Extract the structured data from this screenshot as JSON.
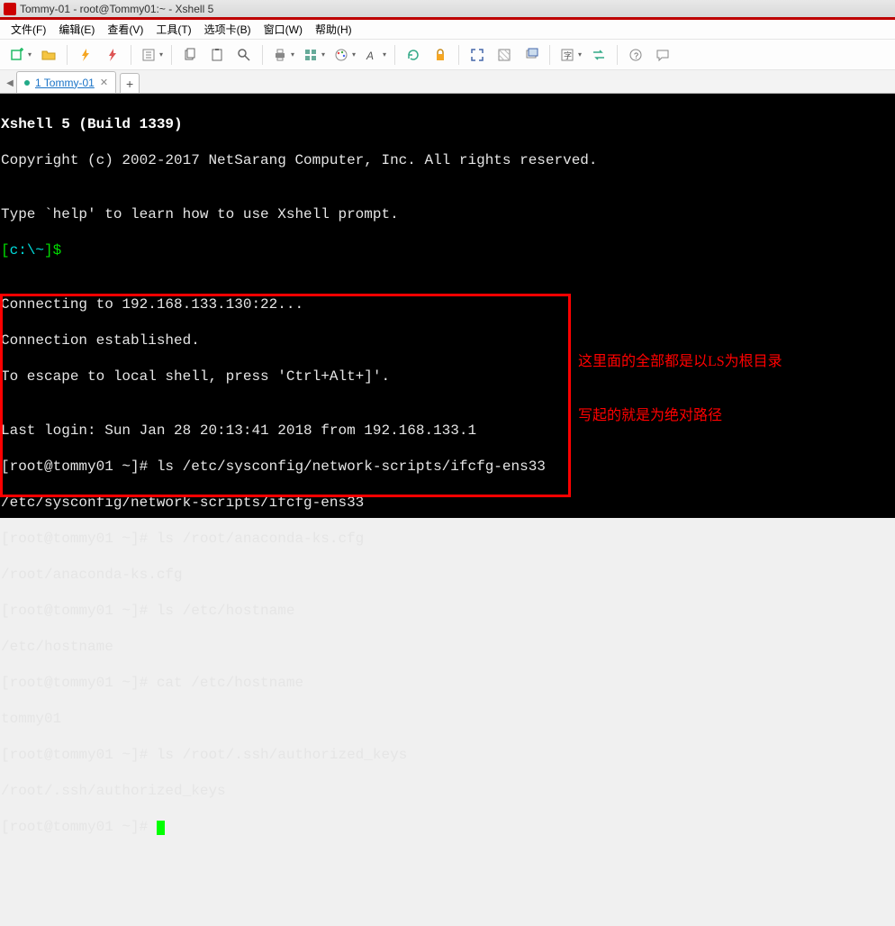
{
  "window": {
    "title": "Tommy-01 - root@Tommy01:~ - Xshell 5"
  },
  "menu": {
    "file": "文件(F)",
    "edit": "编辑(E)",
    "view": "查看(V)",
    "tools": "工具(T)",
    "tabs": "选项卡(B)",
    "window": "窗口(W)",
    "help": "帮助(H)"
  },
  "tab": {
    "label": "1 Tommy-01",
    "add": "+"
  },
  "term": {
    "banner1": "Xshell 5 (Build 1339)",
    "banner2": "Copyright (c) 2002-2017 NetSarang Computer, Inc. All rights reserved.",
    "blank": "",
    "help": "Type `help' to learn how to use Xshell prompt.",
    "local_prompt_open": "[",
    "local_prompt_path": "c:\\~",
    "local_prompt_close": "]$ ",
    "conn1": "Connecting to 192.168.133.130:22...",
    "conn2": "Connection established.",
    "conn3": "To escape to local shell, press 'Ctrl+Alt+]'.",
    "last": "Last login: Sun Jan 28 20:13:41 2018 from 192.168.133.1",
    "p1": "[root@tommy01 ~]# ls /etc/sysconfig/network-scripts/ifcfg-ens33",
    "o1": "/etc/sysconfig/network-scripts/ifcfg-ens33",
    "p2": "[root@tommy01 ~]# ls /root/anaconda-ks.cfg",
    "o2": "/root/anaconda-ks.cfg",
    "p3": "[root@tommy01 ~]# ls /etc/hostname",
    "o3": "/etc/hostname",
    "p4": "[root@tommy01 ~]# cat /etc/hostname",
    "o4": "tommy01",
    "p5": "[root@tommy01 ~]# ls /root/.ssh/authorized_keys",
    "o5": "/root/.ssh/authorized_keys",
    "p6": "[root@tommy01 ~]# "
  },
  "annotation": {
    "line1": "这里面的全部都是以LS为根目录",
    "line2": "写起的就是为绝对路径"
  }
}
